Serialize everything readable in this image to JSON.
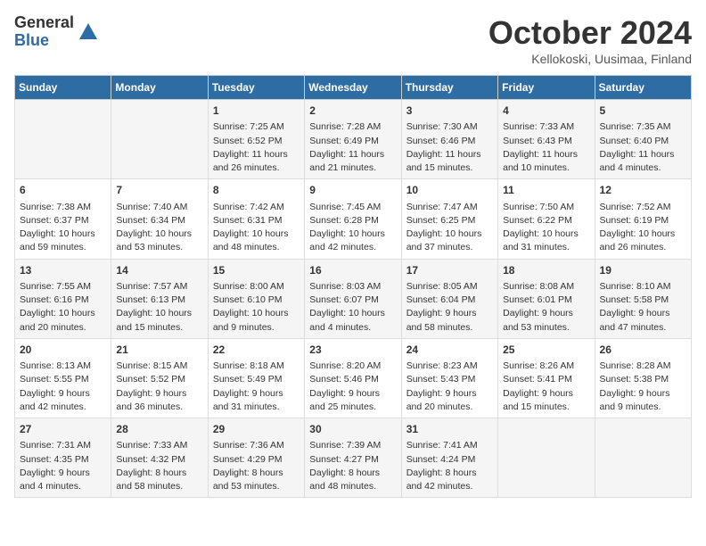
{
  "logo": {
    "general": "General",
    "blue": "Blue"
  },
  "title": "October 2024",
  "subtitle": "Kellokoski, Uusimaa, Finland",
  "headers": [
    "Sunday",
    "Monday",
    "Tuesday",
    "Wednesday",
    "Thursday",
    "Friday",
    "Saturday"
  ],
  "weeks": [
    [
      {
        "day": "",
        "content": ""
      },
      {
        "day": "",
        "content": ""
      },
      {
        "day": "1",
        "content": "Sunrise: 7:25 AM\nSunset: 6:52 PM\nDaylight: 11 hours\nand 26 minutes."
      },
      {
        "day": "2",
        "content": "Sunrise: 7:28 AM\nSunset: 6:49 PM\nDaylight: 11 hours\nand 21 minutes."
      },
      {
        "day": "3",
        "content": "Sunrise: 7:30 AM\nSunset: 6:46 PM\nDaylight: 11 hours\nand 15 minutes."
      },
      {
        "day": "4",
        "content": "Sunrise: 7:33 AM\nSunset: 6:43 PM\nDaylight: 11 hours\nand 10 minutes."
      },
      {
        "day": "5",
        "content": "Sunrise: 7:35 AM\nSunset: 6:40 PM\nDaylight: 11 hours\nand 4 minutes."
      }
    ],
    [
      {
        "day": "6",
        "content": "Sunrise: 7:38 AM\nSunset: 6:37 PM\nDaylight: 10 hours\nand 59 minutes."
      },
      {
        "day": "7",
        "content": "Sunrise: 7:40 AM\nSunset: 6:34 PM\nDaylight: 10 hours\nand 53 minutes."
      },
      {
        "day": "8",
        "content": "Sunrise: 7:42 AM\nSunset: 6:31 PM\nDaylight: 10 hours\nand 48 minutes."
      },
      {
        "day": "9",
        "content": "Sunrise: 7:45 AM\nSunset: 6:28 PM\nDaylight: 10 hours\nand 42 minutes."
      },
      {
        "day": "10",
        "content": "Sunrise: 7:47 AM\nSunset: 6:25 PM\nDaylight: 10 hours\nand 37 minutes."
      },
      {
        "day": "11",
        "content": "Sunrise: 7:50 AM\nSunset: 6:22 PM\nDaylight: 10 hours\nand 31 minutes."
      },
      {
        "day": "12",
        "content": "Sunrise: 7:52 AM\nSunset: 6:19 PM\nDaylight: 10 hours\nand 26 minutes."
      }
    ],
    [
      {
        "day": "13",
        "content": "Sunrise: 7:55 AM\nSunset: 6:16 PM\nDaylight: 10 hours\nand 20 minutes."
      },
      {
        "day": "14",
        "content": "Sunrise: 7:57 AM\nSunset: 6:13 PM\nDaylight: 10 hours\nand 15 minutes."
      },
      {
        "day": "15",
        "content": "Sunrise: 8:00 AM\nSunset: 6:10 PM\nDaylight: 10 hours\nand 9 minutes."
      },
      {
        "day": "16",
        "content": "Sunrise: 8:03 AM\nSunset: 6:07 PM\nDaylight: 10 hours\nand 4 minutes."
      },
      {
        "day": "17",
        "content": "Sunrise: 8:05 AM\nSunset: 6:04 PM\nDaylight: 9 hours\nand 58 minutes."
      },
      {
        "day": "18",
        "content": "Sunrise: 8:08 AM\nSunset: 6:01 PM\nDaylight: 9 hours\nand 53 minutes."
      },
      {
        "day": "19",
        "content": "Sunrise: 8:10 AM\nSunset: 5:58 PM\nDaylight: 9 hours\nand 47 minutes."
      }
    ],
    [
      {
        "day": "20",
        "content": "Sunrise: 8:13 AM\nSunset: 5:55 PM\nDaylight: 9 hours\nand 42 minutes."
      },
      {
        "day": "21",
        "content": "Sunrise: 8:15 AM\nSunset: 5:52 PM\nDaylight: 9 hours\nand 36 minutes."
      },
      {
        "day": "22",
        "content": "Sunrise: 8:18 AM\nSunset: 5:49 PM\nDaylight: 9 hours\nand 31 minutes."
      },
      {
        "day": "23",
        "content": "Sunrise: 8:20 AM\nSunset: 5:46 PM\nDaylight: 9 hours\nand 25 minutes."
      },
      {
        "day": "24",
        "content": "Sunrise: 8:23 AM\nSunset: 5:43 PM\nDaylight: 9 hours\nand 20 minutes."
      },
      {
        "day": "25",
        "content": "Sunrise: 8:26 AM\nSunset: 5:41 PM\nDaylight: 9 hours\nand 15 minutes."
      },
      {
        "day": "26",
        "content": "Sunrise: 8:28 AM\nSunset: 5:38 PM\nDaylight: 9 hours\nand 9 minutes."
      }
    ],
    [
      {
        "day": "27",
        "content": "Sunrise: 7:31 AM\nSunset: 4:35 PM\nDaylight: 9 hours\nand 4 minutes."
      },
      {
        "day": "28",
        "content": "Sunrise: 7:33 AM\nSunset: 4:32 PM\nDaylight: 8 hours\nand 58 minutes."
      },
      {
        "day": "29",
        "content": "Sunrise: 7:36 AM\nSunset: 4:29 PM\nDaylight: 8 hours\nand 53 minutes."
      },
      {
        "day": "30",
        "content": "Sunrise: 7:39 AM\nSunset: 4:27 PM\nDaylight: 8 hours\nand 48 minutes."
      },
      {
        "day": "31",
        "content": "Sunrise: 7:41 AM\nSunset: 4:24 PM\nDaylight: 8 hours\nand 42 minutes."
      },
      {
        "day": "",
        "content": ""
      },
      {
        "day": "",
        "content": ""
      }
    ]
  ]
}
